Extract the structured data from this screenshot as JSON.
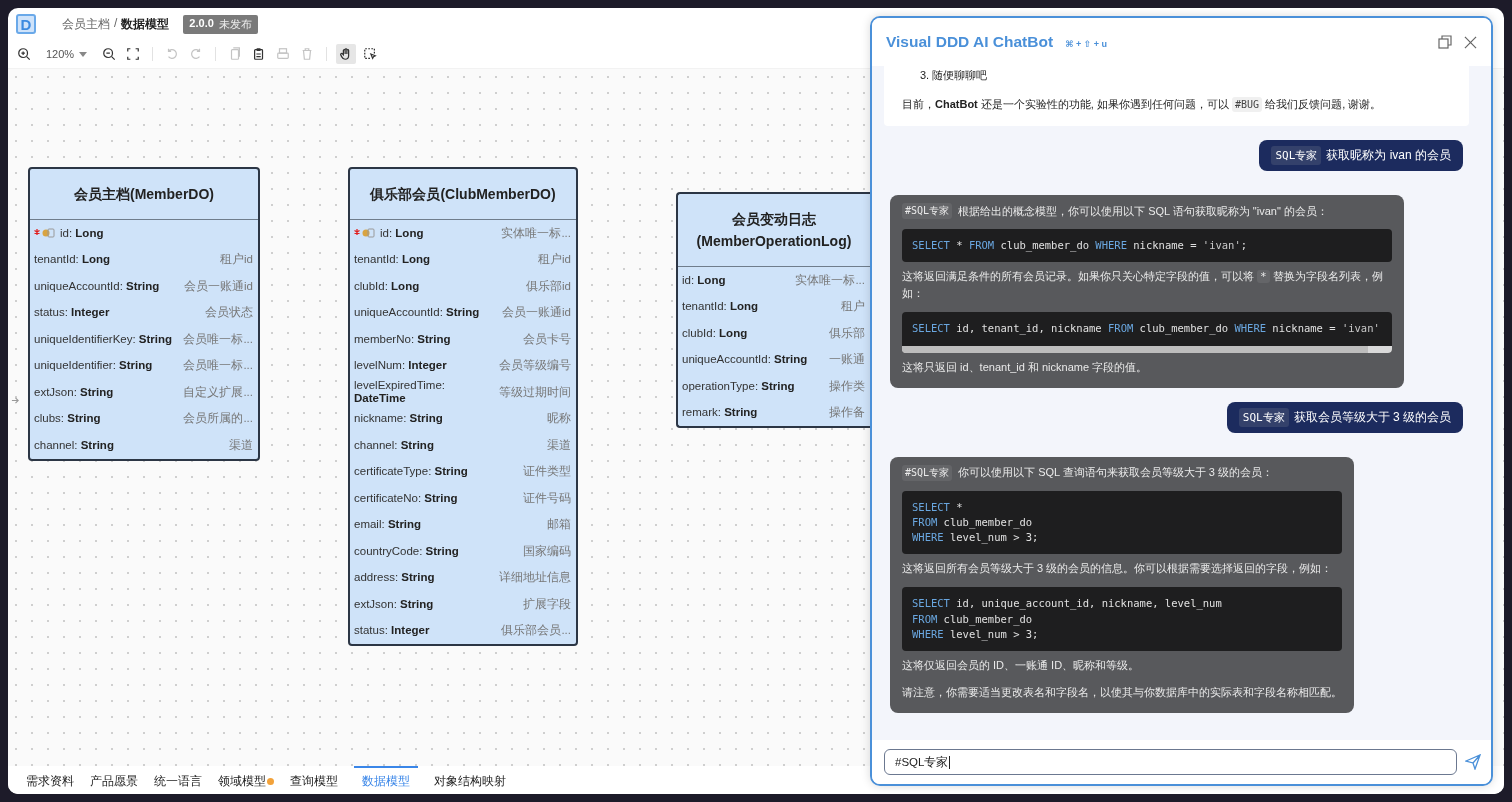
{
  "app": {
    "logo": "D",
    "breadcrumb": [
      {
        "text": "会员主档",
        "current": false
      },
      {
        "text": "/",
        "current": false
      },
      {
        "text": "数据模型",
        "current": true
      }
    ],
    "version": {
      "number": "2.0.0",
      "status": "未发布"
    }
  },
  "toolbar": {
    "zoom": "120%",
    "buttons": [
      {
        "disabled": false,
        "selected": false
      },
      {
        "disabled": false,
        "selected": false
      },
      {
        "disabled": false,
        "selected": false
      },
      {
        "disabled": true,
        "selected": false
      },
      {
        "disabled": true,
        "selected": false
      },
      {
        "disabled": true,
        "selected": false
      },
      {
        "disabled": false,
        "selected": false
      },
      {
        "disabled": true,
        "selected": false
      },
      {
        "disabled": true,
        "selected": false
      },
      {
        "disabled": false,
        "selected": true
      },
      {
        "disabled": false,
        "selected": false
      }
    ]
  },
  "tables": [
    {
      "title": "会员主档(MemberDO)",
      "fields": [
        {
          "label": "id: **Long**",
          "primary_key": true
        },
        {
          "label": "tenantId: **Long**",
          "desc": "租户id",
          "primary_key": false
        },
        {
          "label": "uniqueAccountId: **String**",
          "desc": "会员一账通id",
          "primary_key": false
        },
        {
          "label": "status: **Integer**",
          "desc": "会员状态",
          "primary_key": false
        },
        {
          "label": "uniqueIdentifierKey: **String**",
          "desc": "会员唯一标...",
          "primary_key": false
        },
        {
          "label": "uniqueIdentifier: **String**",
          "desc": "会员唯一标...",
          "primary_key": false
        },
        {
          "label": "extJson: **String**",
          "desc": "自定义扩展...",
          "primary_key": false
        },
        {
          "label": "clubs: **String**",
          "desc": "会员所属的...",
          "primary_key": false
        },
        {
          "label": "channel: **String**",
          "desc": "渠道",
          "primary_key": false
        }
      ]
    },
    {
      "title": "俱乐部会员(ClubMemberDO)",
      "fields": [
        {
          "label": "id: **Long**",
          "desc": "实体唯一标...",
          "primary_key": true
        },
        {
          "label": "tenantId: **Long**",
          "desc": "租户id",
          "primary_key": false
        },
        {
          "label": "clubId: **Long**",
          "desc": "俱乐部id",
          "primary_key": false
        },
        {
          "label": "uniqueAccountId: **String**",
          "desc": "会员一账通id",
          "primary_key": false
        },
        {
          "label": "memberNo: **String**",
          "desc": "会员卡号",
          "primary_key": false
        },
        {
          "label": "levelNum: **Integer**",
          "desc": "会员等级编号",
          "primary_key": false
        },
        {
          "label": "levelExpiredTime: **DateTime**",
          "desc": "等级过期时间",
          "primary_key": false
        },
        {
          "label": "nickname: **String**",
          "desc": "昵称",
          "primary_key": false
        },
        {
          "label": "channel: **String**",
          "desc": "渠道",
          "primary_key": false
        },
        {
          "label": "certificateType: **String**",
          "desc": "证件类型",
          "primary_key": false
        },
        {
          "label": "certificateNo: **String**",
          "desc": "证件号码",
          "primary_key": false
        },
        {
          "label": "email: **String**",
          "desc": "邮箱",
          "primary_key": false
        },
        {
          "label": "countryCode: **String**",
          "desc": "国家编码",
          "primary_key": false
        },
        {
          "label": "address: **String**",
          "desc": "详细地址信息",
          "primary_key": false
        },
        {
          "label": "extJson: **String**",
          "desc": "扩展字段",
          "primary_key": false
        },
        {
          "label": "status: **Integer**",
          "desc": "俱乐部会员...",
          "primary_key": false
        }
      ]
    },
    {
      "title": "会员变动日志(MemberOperationLog)",
      "fields": [
        {
          "label": "id: **Long**",
          "desc": "实体唯一标...",
          "primary_key": false
        },
        {
          "label": "tenantId: **Long**",
          "desc": "租户",
          "primary_key": false
        },
        {
          "label": "clubId: **Long**",
          "desc": "俱乐部",
          "primary_key": false
        },
        {
          "label": "uniqueAccountId: **String**",
          "desc": "一账通",
          "primary_key": false
        },
        {
          "label": "operationType: **String**",
          "desc": "操作类",
          "primary_key": false
        },
        {
          "label": "remark: **String**",
          "desc": "操作备",
          "primary_key": false
        }
      ]
    }
  ],
  "bottom_tabs": [
    {
      "label": "需求资料",
      "selected": false,
      "dot": false
    },
    {
      "label": "产品愿景",
      "selected": false,
      "dot": false
    },
    {
      "label": "统一语言",
      "selected": false,
      "dot": false
    },
    {
      "label": "领域模型",
      "selected": false,
      "dot": true
    },
    {
      "label": "查询模型",
      "selected": false,
      "dot": false
    },
    {
      "label": "数据模型",
      "selected": true,
      "dot": false
    },
    {
      "label": "对象结构映射",
      "selected": false,
      "dot": false
    }
  ],
  "chat": {
    "title": "Visual DDD AI ChatBot",
    "shortcut": "⌘ + ⇧ + u",
    "welcome": {
      "list_item": "3. 随便聊聊吧",
      "before": "目前，**ChatBot** 还是一个实验性的功能, 如果你遇到任何问题，可以 ",
      "code": "#BUG",
      "after": " 给我们反馈问题, 谢谢。"
    },
    "messages": [
      {
        "kind": "user",
        "tag": "SQL专家",
        "text": "获取昵称为 ivan 的会员"
      },
      {
        "kind": "bot",
        "tag": "#SQL专家",
        "text": "根据给出的概念模型，你可以使用以下 SQL 语句获取昵称为 \"ivan\" 的会员：",
        "blocks": [
          {
            "kind": "code",
            "scroll": false,
            "lines": [
              [
                {
                  "t": "SELECT",
                  "kind": "kw"
                },
                {
                  "t": " * ",
                  "kind": "plain"
                },
                {
                  "t": "FROM",
                  "kind": "kw"
                },
                {
                  "t": " club_member_do ",
                  "kind": "plain"
                },
                {
                  "t": "WHERE",
                  "kind": "kw"
                },
                {
                  "t": " nickname = ",
                  "kind": "plain"
                },
                {
                  "t": "'ivan'",
                  "kind": "str"
                },
                {
                  "t": ";",
                  "kind": "plain"
                }
              ]
            ]
          },
          {
            "kind": "text",
            "before": "这将返回满足条件的所有会员记录。如果你只关心特定字段的值，可以将 ",
            "code": "*",
            "after": " 替换为字段名列表，例如："
          },
          {
            "kind": "code",
            "scroll": true,
            "lines": [
              [
                {
                  "t": "SELECT",
                  "kind": "kw"
                },
                {
                  "t": " id, tenant_id, nickname ",
                  "kind": "plain"
                },
                {
                  "t": "FROM",
                  "kind": "kw"
                },
                {
                  "t": " club_member_do ",
                  "kind": "plain"
                },
                {
                  "t": "WHERE",
                  "kind": "kw"
                },
                {
                  "t": " nickname = ",
                  "kind": "plain"
                },
                {
                  "t": "'ivan'",
                  "kind": "str"
                }
              ]
            ]
          },
          {
            "kind": "text",
            "before": "这将只返回 id、tenant_id 和 nickname 字段的值。"
          }
        ]
      },
      {
        "kind": "user",
        "tag": "SQL专家",
        "text": "获取会员等级大于 3 级的会员"
      },
      {
        "kind": "bot",
        "tag": "#SQL专家",
        "text": "你可以使用以下 SQL 查询语句来获取会员等级大于 3 级的会员：",
        "blocks": [
          {
            "kind": "code",
            "scroll": false,
            "lines": [
              [
                {
                  "t": "SELECT",
                  "kind": "kw"
                },
                {
                  "t": " *",
                  "kind": "plain"
                }
              ],
              [
                {
                  "t": "FROM",
                  "kind": "kw"
                },
                {
                  "t": " club_member_do",
                  "kind": "plain"
                }
              ],
              [
                {
                  "t": "WHERE",
                  "kind": "kw"
                },
                {
                  "t": " level_num > 3;",
                  "kind": "plain"
                }
              ]
            ]
          },
          {
            "kind": "text",
            "before": "这将返回所有会员等级大于 3 级的会员的信息。你可以根据需要选择返回的字段，例如："
          },
          {
            "kind": "code",
            "scroll": false,
            "lines": [
              [
                {
                  "t": "SELECT",
                  "kind": "kw"
                },
                {
                  "t": " id, unique_account_id, nickname, level_num",
                  "kind": "plain"
                }
              ],
              [
                {
                  "t": "FROM",
                  "kind": "kw"
                },
                {
                  "t": " club_member_do",
                  "kind": "plain"
                }
              ],
              [
                {
                  "t": "WHERE",
                  "kind": "kw"
                },
                {
                  "t": " level_num > 3;",
                  "kind": "plain"
                }
              ]
            ]
          },
          {
            "kind": "text",
            "before": "这将仅返回会员的 ID、一账通 ID、昵称和等级。"
          },
          {
            "kind": "text",
            "before": "请注意，你需要适当更改表名和字段名，以使其与你数据库中的实际表和字段名称相匹配。"
          }
        ]
      }
    ],
    "input": {
      "value": "#SQL专家"
    }
  }
}
